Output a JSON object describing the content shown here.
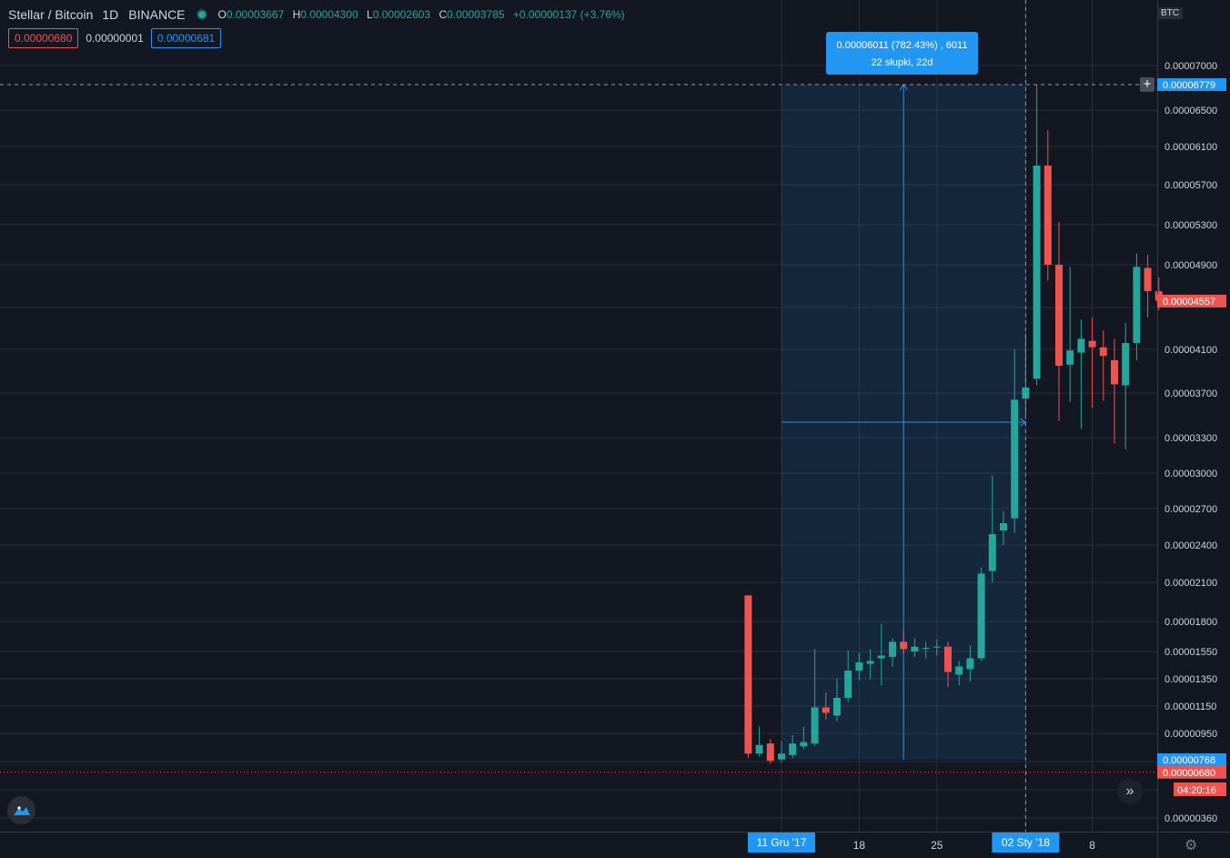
{
  "legend": {
    "symbol": "Stellar / Bitcoin",
    "interval": "1D",
    "exchange": "BINANCE",
    "o_key": "O",
    "o": "0.00003667",
    "h_key": "H",
    "h": "0.00004300",
    "l_key": "L",
    "l": "0.00002603",
    "c_key": "C",
    "c": "0.00003785",
    "change": "+0.00000137 (+3.76%)"
  },
  "trade": {
    "sell": "0.00000680",
    "spread": "0.00000001",
    "buy": "0.00000681"
  },
  "measure": {
    "line1": "0.00006011 (782.43%) , 6011",
    "line2": "22 słupki, 22d"
  },
  "currency": "BTC",
  "countdown": "04:20:16",
  "colors": {
    "up": "#26a69a",
    "down": "#ef5350",
    "accent": "#2196f3",
    "background": "#131722",
    "grid": "#2a2e39"
  },
  "icons": [
    "tradingview-logo-icon",
    "chevrons-right-icon",
    "gear-icon",
    "plus-icon"
  ],
  "chart_data": {
    "type": "candlestick",
    "title": "Stellar / Bitcoin",
    "interval": "1D",
    "y_scale": "log",
    "ylim": [
      3.2e-06,
      8.2e-06
    ],
    "y_ticks": [
      "0.00007000",
      "0.00006500",
      "0.00006100",
      "0.00005700",
      "0.00005300",
      "0.00004900",
      "0.00004100",
      "0.00003700",
      "0.00003300",
      "0.00003000",
      "0.00002700",
      "0.00002400",
      "0.00002100",
      "0.00001800",
      "0.00001550",
      "0.00001350",
      "0.00001150",
      "0.00000950",
      "0.00000360"
    ],
    "x_tick_labels": [
      {
        "date": "2017-12-11",
        "label": "11 Gru '17",
        "highlight": true
      },
      {
        "date": "2017-12-18",
        "label": "18"
      },
      {
        "date": "2017-12-25",
        "label": "25"
      },
      {
        "date": "2018-01-02",
        "label": "02 Sty '18",
        "highlight": true
      },
      {
        "date": "2018-01-08",
        "label": "8"
      }
    ],
    "price_labels": [
      {
        "value": 6.779e-05,
        "text": "0.00006779",
        "kind": "crosshair"
      },
      {
        "value": 4.557e-05,
        "text": "0.00004557",
        "kind": "last"
      },
      {
        "value": 7.68e-06,
        "text": "0.00000768",
        "kind": "measure"
      },
      {
        "value": 6.8e-06,
        "text": "0.00000680",
        "kind": "bid"
      }
    ],
    "measure": {
      "from_date": "2017-12-11",
      "to_date": "2018-01-02",
      "from_price": 7.68e-06,
      "to_price": 6.779e-05,
      "change_pct": 782.43,
      "bars": 22
    },
    "candles": [
      {
        "date": "2017-12-08",
        "o": 2e-05,
        "h": 2e-05,
        "l": 7.8e-06,
        "c": 8.1e-06
      },
      {
        "date": "2017-12-09",
        "o": 8.1e-06,
        "h": 1e-05,
        "l": 7.9e-06,
        "c": 8.7e-06
      },
      {
        "date": "2017-12-10",
        "o": 8.8e-06,
        "h": 9.1e-06,
        "l": 7.4e-06,
        "c": 7.6e-06
      },
      {
        "date": "2017-12-11",
        "o": 7.7e-06,
        "h": 9e-06,
        "l": 7.5e-06,
        "c": 8.1e-06
      },
      {
        "date": "2017-12-12",
        "o": 8e-06,
        "h": 9.4e-06,
        "l": 7.8e-06,
        "c": 8.8e-06
      },
      {
        "date": "2017-12-13",
        "o": 8.6e-06,
        "h": 1e-05,
        "l": 8.4e-06,
        "c": 8.9e-06
      },
      {
        "date": "2017-12-14",
        "o": 8.8e-06,
        "h": 1.57e-05,
        "l": 8.6e-06,
        "c": 1.14e-05
      },
      {
        "date": "2017-12-15",
        "o": 1.14e-05,
        "h": 1.25e-05,
        "l": 1.05e-05,
        "c": 1.1e-05
      },
      {
        "date": "2017-12-16",
        "o": 1.08e-05,
        "h": 1.35e-05,
        "l": 1.04e-05,
        "c": 1.21e-05
      },
      {
        "date": "2017-12-17",
        "o": 1.21e-05,
        "h": 1.56e-05,
        "l": 1.18e-05,
        "c": 1.41e-05
      },
      {
        "date": "2017-12-18",
        "o": 1.41e-05,
        "h": 1.54e-05,
        "l": 1.34e-05,
        "c": 1.47e-05
      },
      {
        "date": "2017-12-19",
        "o": 1.46e-05,
        "h": 1.57e-05,
        "l": 1.35e-05,
        "c": 1.48e-05
      },
      {
        "date": "2017-12-20",
        "o": 1.5e-05,
        "h": 1.78e-05,
        "l": 1.3e-05,
        "c": 1.52e-05
      },
      {
        "date": "2017-12-21",
        "o": 1.51e-05,
        "h": 1.66e-05,
        "l": 1.44e-05,
        "c": 1.63e-05
      },
      {
        "date": "2017-12-22",
        "o": 1.63e-05,
        "h": 1.72e-05,
        "l": 1.53e-05,
        "c": 1.57e-05
      },
      {
        "date": "2017-12-23",
        "o": 1.55e-05,
        "h": 1.66e-05,
        "l": 1.51e-05,
        "c": 1.59e-05
      },
      {
        "date": "2017-12-24",
        "o": 1.58e-05,
        "h": 1.63e-05,
        "l": 1.5e-05,
        "c": 1.58e-05
      },
      {
        "date": "2017-12-25",
        "o": 1.59e-05,
        "h": 1.65e-05,
        "l": 1.52e-05,
        "c": 1.59e-05
      },
      {
        "date": "2017-12-26",
        "o": 1.59e-05,
        "h": 1.63e-05,
        "l": 1.29e-05,
        "c": 1.4e-05
      },
      {
        "date": "2017-12-27",
        "o": 1.38e-05,
        "h": 1.48e-05,
        "l": 1.3e-05,
        "c": 1.44e-05
      },
      {
        "date": "2017-12-28",
        "o": 1.42e-05,
        "h": 1.6e-05,
        "l": 1.33e-05,
        "c": 1.5e-05
      },
      {
        "date": "2017-12-29",
        "o": 1.5e-05,
        "h": 2.22e-05,
        "l": 1.48e-05,
        "c": 2.17e-05
      },
      {
        "date": "2017-12-30",
        "o": 2.19e-05,
        "h": 2.98e-05,
        "l": 2.1e-05,
        "c": 2.49e-05
      },
      {
        "date": "2017-12-31",
        "o": 2.52e-05,
        "h": 2.68e-05,
        "l": 2.4e-05,
        "c": 2.58e-05
      },
      {
        "date": "2018-01-01",
        "o": 2.62e-05,
        "h": 4.1e-05,
        "l": 2.5e-05,
        "c": 3.64e-05
      },
      {
        "date": "2018-01-02",
        "o": 3.65e-05,
        "h": 4.25e-05,
        "l": 3.5e-05,
        "c": 3.75e-05
      },
      {
        "date": "2018-01-03",
        "o": 3.83e-05,
        "h": 6.78e-05,
        "l": 3.77e-05,
        "c": 5.9e-05
      },
      {
        "date": "2018-01-04",
        "o": 5.9e-05,
        "h": 6.28e-05,
        "l": 4.75e-05,
        "c": 4.9e-05
      },
      {
        "date": "2018-01-05",
        "o": 4.9e-05,
        "h": 5.33e-05,
        "l": 3.45e-05,
        "c": 3.95e-05
      },
      {
        "date": "2018-01-06",
        "o": 3.96e-05,
        "h": 4.88e-05,
        "l": 3.62e-05,
        "c": 4.09e-05
      },
      {
        "date": "2018-01-07",
        "o": 4.07e-05,
        "h": 4.38e-05,
        "l": 3.38e-05,
        "c": 4.2e-05
      },
      {
        "date": "2018-01-08",
        "o": 4.18e-05,
        "h": 4.4e-05,
        "l": 3.57e-05,
        "c": 4.12e-05
      },
      {
        "date": "2018-01-09",
        "o": 4.12e-05,
        "h": 4.28e-05,
        "l": 3.63e-05,
        "c": 4.04e-05
      },
      {
        "date": "2018-01-10",
        "o": 4e-05,
        "h": 4.2e-05,
        "l": 3.25e-05,
        "c": 3.78e-05
      },
      {
        "date": "2018-01-11",
        "o": 3.77e-05,
        "h": 4.35e-05,
        "l": 3.2e-05,
        "c": 4.16e-05
      },
      {
        "date": "2018-01-12",
        "o": 4.16e-05,
        "h": 5.01e-05,
        "l": 4e-05,
        "c": 4.88e-05
      },
      {
        "date": "2018-01-13",
        "o": 4.87e-05,
        "h": 5e-05,
        "l": 4.4e-05,
        "c": 4.65e-05
      },
      {
        "date": "2018-01-14",
        "o": 4.65e-05,
        "h": 4.78e-05,
        "l": 4.47e-05,
        "c": 4.56e-05
      }
    ]
  }
}
